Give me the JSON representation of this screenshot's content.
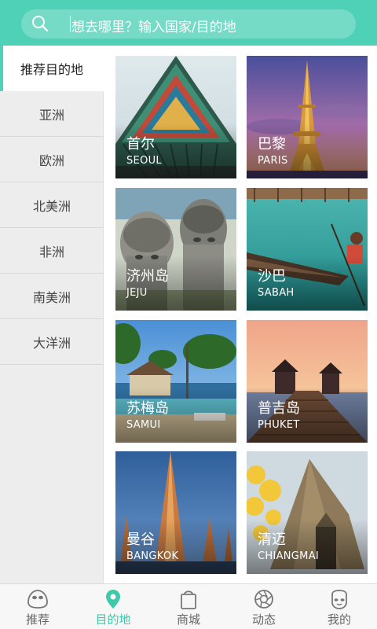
{
  "search": {
    "placeholder": "想去哪里？输入国家/目的地",
    "icon": "search-icon"
  },
  "sidebar": {
    "items": [
      {
        "label": "推荐目的地",
        "active": true
      },
      {
        "label": "亚洲"
      },
      {
        "label": "欧洲"
      },
      {
        "label": "北美洲"
      },
      {
        "label": "非洲"
      },
      {
        "label": "南美洲"
      },
      {
        "label": "大洋洲"
      }
    ]
  },
  "destinations": [
    {
      "cn": "首尔",
      "en": "SEOUL"
    },
    {
      "cn": "巴黎",
      "en": "PARIS"
    },
    {
      "cn": "济州岛",
      "en": "JEJU"
    },
    {
      "cn": "沙巴",
      "en": "SABAH"
    },
    {
      "cn": "苏梅岛",
      "en": "SAMUI"
    },
    {
      "cn": "普吉岛",
      "en": "PHUKET"
    },
    {
      "cn": "曼谷",
      "en": "BANGKOK"
    },
    {
      "cn": "清迈",
      "en": "CHIANGMAI"
    }
  ],
  "tabbar": {
    "tabs": [
      {
        "label": "推荐",
        "icon": "home-icon"
      },
      {
        "label": "目的地",
        "icon": "location-pin-icon",
        "active": true
      },
      {
        "label": "商城",
        "icon": "shopping-bag-icon"
      },
      {
        "label": "动态",
        "icon": "camera-aperture-icon"
      },
      {
        "label": "我的",
        "icon": "profile-icon"
      }
    ]
  },
  "colors": {
    "accent": "#4fd1b8",
    "tab_active": "#3ecaa9",
    "sidebar_bg": "#ededed"
  }
}
